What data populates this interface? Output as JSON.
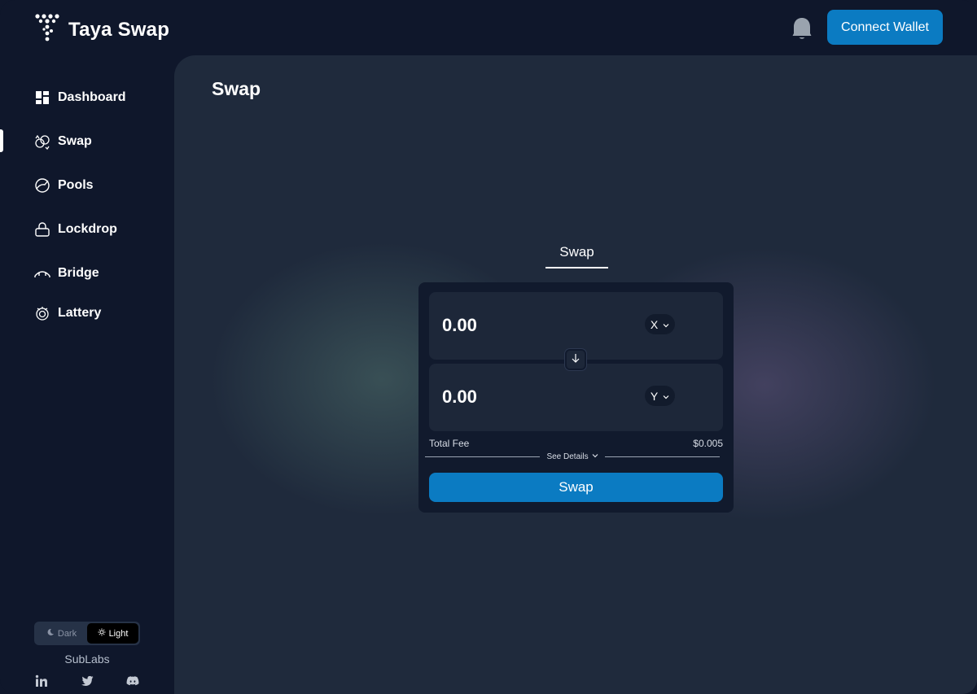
{
  "app": {
    "name": "Taya Swap",
    "logo_icon": "taya-logo-icon"
  },
  "header": {
    "bell_icon": "bell-icon",
    "connect_wallet_label": "Connect Wallet",
    "accent_color": "#0b7bc2"
  },
  "sidebar": {
    "active_item": "Swap",
    "items": [
      {
        "label": "Dashboard",
        "icon": "dashboard-icon"
      },
      {
        "label": "Swap",
        "icon": "swap-icon"
      },
      {
        "label": "Pools",
        "icon": "pools-icon"
      },
      {
        "label": "Lockdrop",
        "icon": "lock-icon"
      },
      {
        "label": "Bridge",
        "icon": "bridge-icon"
      },
      {
        "label": "Lattery",
        "icon": "lottery-icon"
      }
    ],
    "theme": {
      "dark_label": "Dark",
      "light_label": "Light",
      "selected": "Light"
    },
    "company": "SubLabs",
    "socials": [
      "linkedin-icon",
      "twitter-icon",
      "discord-icon"
    ]
  },
  "main": {
    "page_title": "Swap",
    "tab_label": "Swap",
    "swap_card": {
      "from": {
        "amount": "0.00",
        "token": "X"
      },
      "to": {
        "amount": "0.00",
        "token": "Y"
      },
      "total_fee_label": "Total Fee",
      "total_fee_value": "$0.005",
      "see_details_label": "See Details",
      "swap_button_label": "Swap"
    }
  }
}
